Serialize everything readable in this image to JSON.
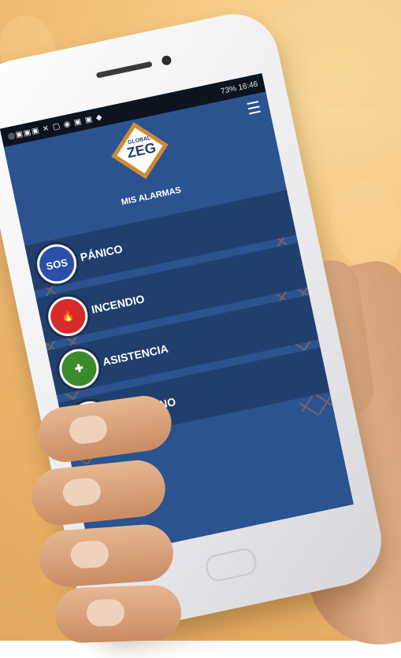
{
  "statusbar": {
    "left_icons": "◎▣▣▣ ✕ ▢ ◉ ▣ ▣ ◆",
    "right_text": "73% 16:46"
  },
  "header": {
    "logo_small": "GLOBAL",
    "logo_big": "ZEG",
    "title": "MIS ALARMAS"
  },
  "alarms": [
    {
      "label": "PÁNICO",
      "icon": "sos-icon",
      "badge_text": "SOS",
      "color": "#2b4fa8"
    },
    {
      "label": "INCENDIO",
      "icon": "fire-icon",
      "badge_text": "🔥",
      "color": "#d72a2a"
    },
    {
      "label": "ASISTENCIA",
      "icon": "medic-icon",
      "badge_text": "✚",
      "color": "#3a8b2b"
    },
    {
      "label": "EN CAMINO",
      "icon": "route-icon",
      "badge_text": "↻",
      "color": "#f0c52a"
    }
  ],
  "colors": {
    "screen_bg": "#2a5390",
    "alarm_bg": "#213f6d",
    "lattice": "#b9743a"
  }
}
